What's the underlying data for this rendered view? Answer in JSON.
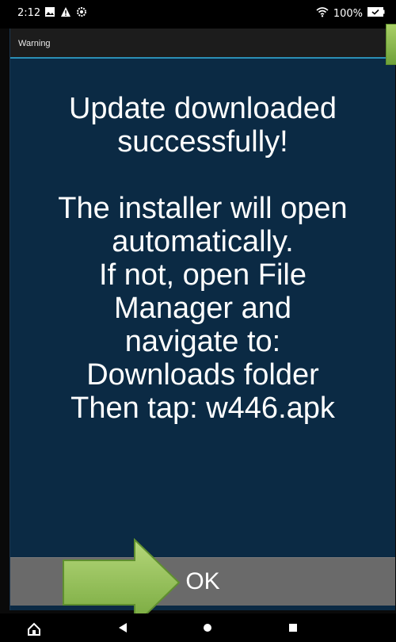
{
  "status_bar": {
    "time": "2:12",
    "battery": "100%",
    "left_icons": [
      "photo-icon",
      "warning-icon",
      "settings-icon"
    ],
    "right_icons": [
      "wifi-icon",
      "battery-icon"
    ]
  },
  "dialog": {
    "title": "Warning",
    "message_lines": [
      "Update downloaded",
      "successfully!",
      "",
      "The installer will open",
      "automatically.",
      "If not, open File",
      "Manager and",
      "navigate to:",
      "Downloads folder",
      "Then tap: w446.apk"
    ],
    "ok_label": "OK"
  },
  "colors": {
    "dialog_background": "#0b2a44",
    "header_accent": "#2b8fb5",
    "button_background": "#6a6a6a",
    "arrow_green": "#8dbf4f"
  },
  "nav_bar": {
    "buttons": [
      "home-icon",
      "back-icon",
      "home-circle-icon",
      "recents-icon"
    ]
  }
}
